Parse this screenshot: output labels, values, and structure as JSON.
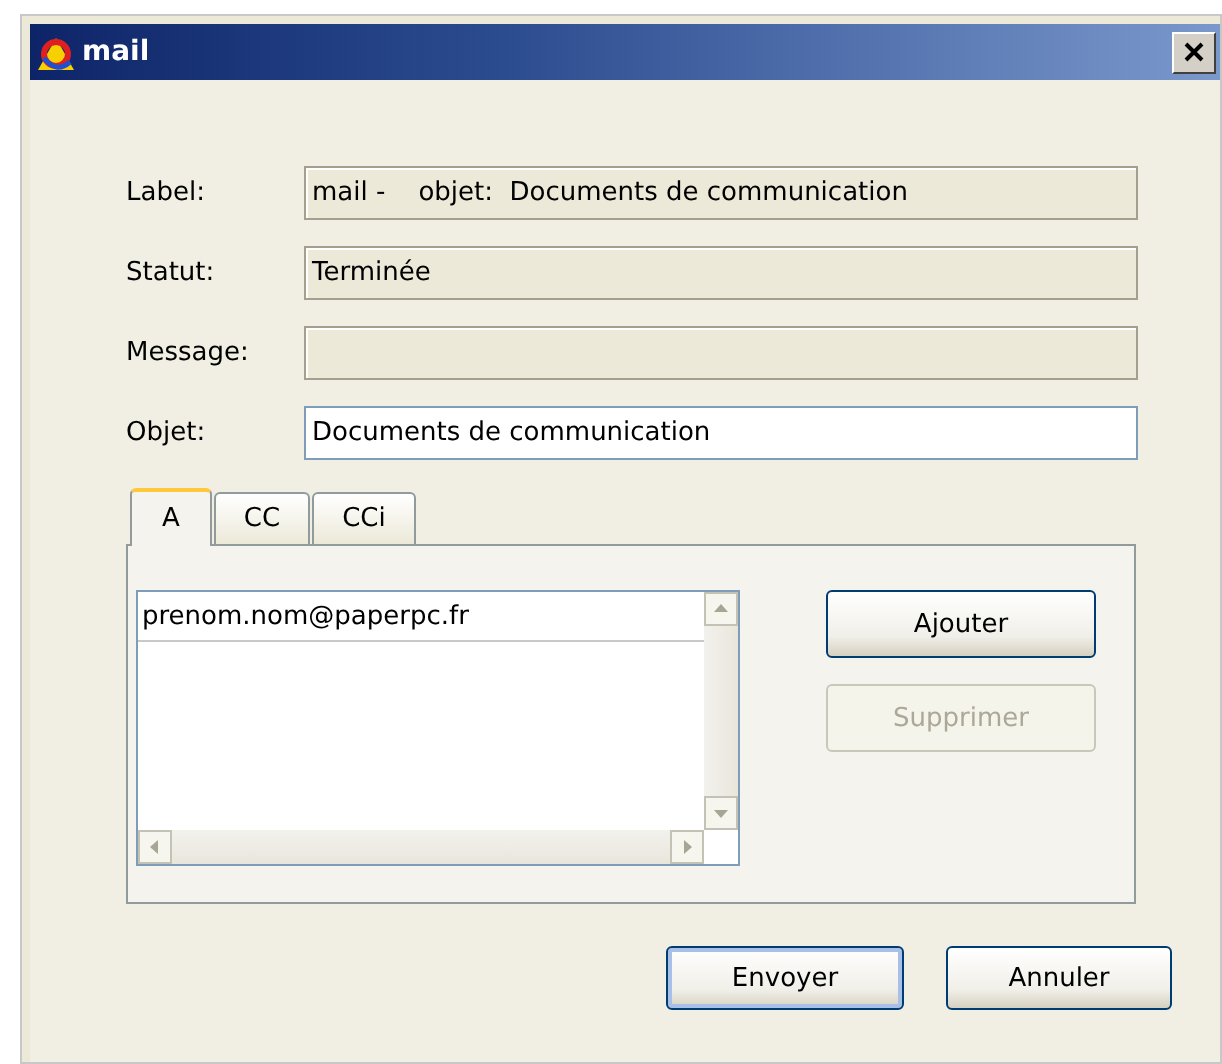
{
  "window": {
    "title": "mail"
  },
  "fields": [
    {
      "label": "Label:",
      "value": "mail -    objet:  Documents de communication",
      "readonly": true
    },
    {
      "label": "Statut:",
      "value": "Terminée",
      "readonly": true
    },
    {
      "label": "Message:",
      "readonly": true
    },
    {
      "label": "Objet:",
      "value": "Documents de communication",
      "readonly": false
    }
  ],
  "tabs": [
    {
      "label": "A",
      "selected": true
    },
    {
      "label": "CC",
      "selected": false
    },
    {
      "label": "CCi",
      "selected": false
    }
  ],
  "recipients": [
    "prenom.nom@paperpc.fr"
  ],
  "side_buttons": [
    {
      "label": "Ajouter",
      "disabled": false
    },
    {
      "label": "Supprimer",
      "disabled": true
    }
  ],
  "buttons": [
    {
      "label": "Envoyer",
      "default": true
    },
    {
      "label": "Annuler",
      "default": false
    }
  ]
}
